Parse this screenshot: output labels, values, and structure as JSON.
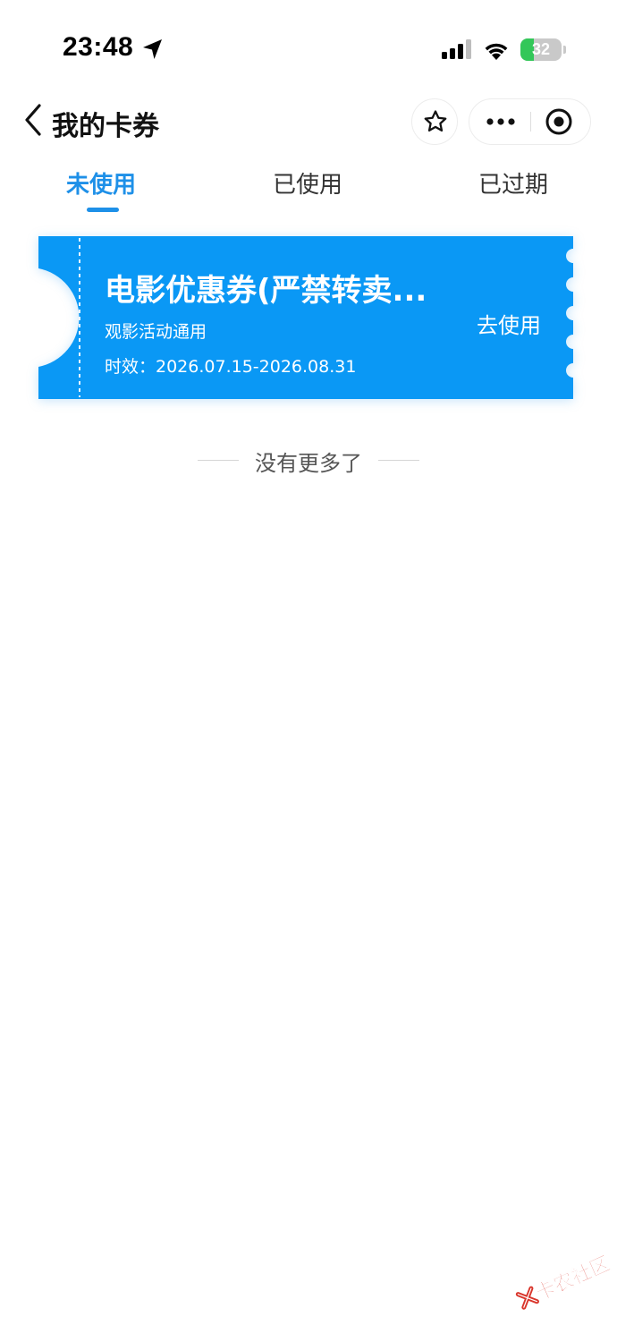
{
  "status_bar": {
    "time": "23:48",
    "battery_level": "32",
    "battery_fraction": 0.32,
    "icons": [
      "location-arrow-icon",
      "cellular-signal-icon",
      "wifi-icon",
      "battery-icon"
    ]
  },
  "nav": {
    "title": "我的卡券",
    "icons": [
      "chevron-left-icon",
      "star-icon",
      "more-dots-icon",
      "target-close-icon"
    ]
  },
  "tabs": [
    {
      "label": "未使用",
      "active": true
    },
    {
      "label": "已使用",
      "active": false
    },
    {
      "label": "已过期",
      "active": false
    }
  ],
  "coupons": [
    {
      "title": "电影优惠券(严禁转卖...",
      "description": "观影活动通用",
      "validity": "时效：2026.07.15-2026.08.31",
      "action": "去使用"
    }
  ],
  "list_end": "没有更多了",
  "watermark": "卡农社区",
  "colors": {
    "accent": "#1e90e8",
    "coupon_bg": "#0a98f5",
    "battery": "#33c759",
    "watermark": "#d9352b"
  }
}
